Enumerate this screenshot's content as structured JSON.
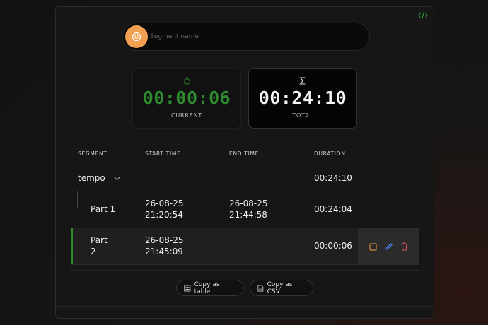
{
  "colors": {
    "accent_green": "#2e8b2e",
    "avatar_orange": "#f0a050",
    "edit_blue": "#4a8cff",
    "delete_red": "#e05050",
    "stop_orange": "#d08a3a"
  },
  "segment_input": {
    "placeholder": "Segment name",
    "value": ""
  },
  "timers": {
    "current": {
      "value": "00:00:06",
      "label": "CURRENT",
      "icon": "stopwatch-icon"
    },
    "total": {
      "value": "00:24:10",
      "label": "TOTAL",
      "icon": "sigma-icon"
    }
  },
  "table": {
    "headers": {
      "segment": "SEGMENT",
      "start": "START TIME",
      "end": "END TIME",
      "duration": "DURATION"
    },
    "segment": {
      "name": "tempo",
      "duration": "00:24:10"
    },
    "parts": [
      {
        "name": "Part 1",
        "start_date": "26-08-25",
        "start_time": "21:20:54",
        "end_date": "26-08-25",
        "end_time": "21:44:58",
        "duration": "00:24:04"
      },
      {
        "name_line1": "Part",
        "name_line2": "2",
        "start_date": "26-08-25",
        "start_time": "21:45:09",
        "duration": "00:00:06"
      }
    ]
  },
  "buttons": {
    "copy_table": "Copy as table",
    "copy_csv": "Copy as CSV"
  }
}
